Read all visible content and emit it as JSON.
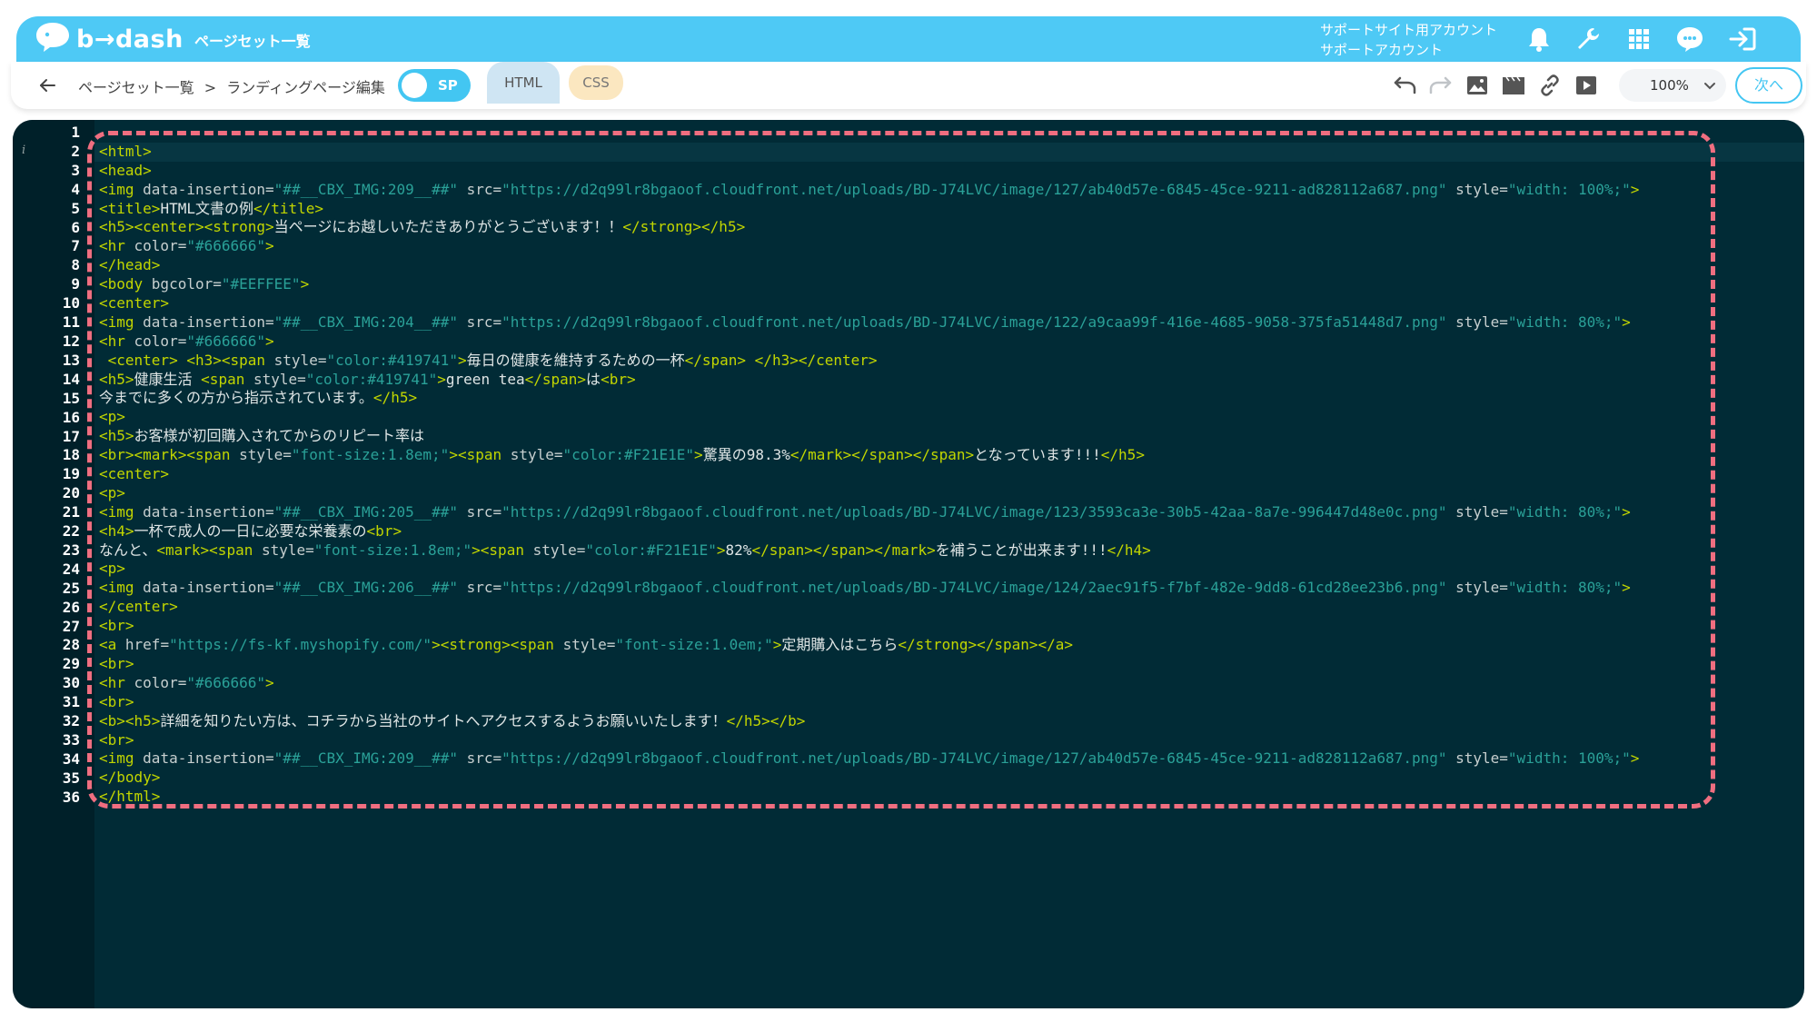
{
  "header": {
    "logo_text": "b→dash",
    "app_title": "ページセット一覧",
    "account_line1": "サポートサイト用アカウント",
    "account_line2": "サポートアカウント"
  },
  "icons": {
    "logo": "speech-bubble-logo-icon",
    "bell": "bell-icon",
    "wrench": "wrench-icon",
    "grid": "apps-grid-icon",
    "help": "support-chat-icon",
    "logout": "logout-icon",
    "back": "back-arrow-icon",
    "undo": "undo-icon",
    "redo": "redo-icon",
    "image": "image-icon",
    "video": "film-icon",
    "link": "link-icon",
    "play": "play-icon",
    "chevron": "chevron-down-icon"
  },
  "toolbar": {
    "breadcrumb_root": "ページセット一覧",
    "breadcrumb_sep": ">",
    "breadcrumb_current": "ランディングページ編集",
    "toggle_label": "SP",
    "tab_html": "HTML",
    "tab_css": "CSS",
    "zoom": "100%",
    "next_label": "次へ"
  },
  "colors": {
    "header_blue": "#4ec9f5",
    "editor_bg": "#012b36",
    "tag": "#c2d600",
    "string": "#2aa198",
    "highlight_border": "#f06e80"
  },
  "editor": {
    "line_count": 36,
    "lines": [
      [],
      [
        [
          "t",
          "<html>"
        ]
      ],
      [
        [
          "t",
          "<head>"
        ]
      ],
      [
        [
          "t",
          "<img "
        ],
        [
          "a",
          "data-insertion="
        ],
        [
          "s",
          "\"##__CBX_IMG:209__##\""
        ],
        [
          "a",
          " src="
        ],
        [
          "s",
          "\"https://d2q99lr8bgaoof.cloudfront.net/uploads/BD-J74LVC/image/127/ab40d57e-6845-45ce-9211-ad828112a687.png\""
        ],
        [
          "a",
          " style="
        ],
        [
          "s",
          "\"width: 100%;\""
        ],
        [
          "t",
          ">"
        ]
      ],
      [
        [
          "t",
          "<title>"
        ],
        [
          "x",
          "HTML文書の例"
        ],
        [
          "t",
          "</title>"
        ]
      ],
      [
        [
          "t",
          "<h5><center><strong>"
        ],
        [
          "x",
          "当ページにお越しいただきありがとうございます！！"
        ],
        [
          "t",
          "</strong></h5>"
        ]
      ],
      [
        [
          "t",
          "<hr "
        ],
        [
          "a",
          "color="
        ],
        [
          "s",
          "\"#666666\""
        ],
        [
          "t",
          ">"
        ]
      ],
      [
        [
          "t",
          "</head>"
        ]
      ],
      [
        [
          "t",
          "<body "
        ],
        [
          "a",
          "bgcolor="
        ],
        [
          "s",
          "\"#EEFFEE\""
        ],
        [
          "t",
          ">"
        ]
      ],
      [
        [
          "t",
          "<center>"
        ]
      ],
      [
        [
          "t",
          "<img "
        ],
        [
          "a",
          "data-insertion="
        ],
        [
          "s",
          "\"##__CBX_IMG:204__##\""
        ],
        [
          "a",
          " src="
        ],
        [
          "s",
          "\"https://d2q99lr8bgaoof.cloudfront.net/uploads/BD-J74LVC/image/122/a9caa99f-416e-4685-9058-375fa51448d7.png\""
        ],
        [
          "a",
          " style="
        ],
        [
          "s",
          "\"width: 80%;\""
        ],
        [
          "t",
          ">"
        ]
      ],
      [
        [
          "t",
          "<hr "
        ],
        [
          "a",
          "color="
        ],
        [
          "s",
          "\"#666666\""
        ],
        [
          "t",
          ">"
        ]
      ],
      [
        [
          "t",
          " <center> <h3><span "
        ],
        [
          "a",
          "style="
        ],
        [
          "s",
          "\"color:#419741\""
        ],
        [
          "t",
          ">"
        ],
        [
          "x",
          "毎日の健康を維持するための一杯"
        ],
        [
          "t",
          "</span> </h3></center>"
        ]
      ],
      [
        [
          "t",
          "<h5>"
        ],
        [
          "x",
          "健康生活 "
        ],
        [
          "t",
          "<span "
        ],
        [
          "a",
          "style="
        ],
        [
          "s",
          "\"color:#419741\""
        ],
        [
          "t",
          ">"
        ],
        [
          "x",
          "green tea"
        ],
        [
          "t",
          "</span>"
        ],
        [
          "x",
          "は"
        ],
        [
          "t",
          "<br>"
        ]
      ],
      [
        [
          "x",
          "今までに多くの方から指示されています。"
        ],
        [
          "t",
          "</h5>"
        ]
      ],
      [
        [
          "t",
          "<p>"
        ]
      ],
      [
        [
          "t",
          "<h5>"
        ],
        [
          "x",
          "お客様が初回購入されてからのリピート率は"
        ]
      ],
      [
        [
          "t",
          "<br><mark><span "
        ],
        [
          "a",
          "style="
        ],
        [
          "s",
          "\"font-size:1.8em;\""
        ],
        [
          "t",
          "><span "
        ],
        [
          "a",
          "style="
        ],
        [
          "s",
          "\"color:#F21E1E\""
        ],
        [
          "t",
          ">"
        ],
        [
          "x",
          "驚異の98.3%"
        ],
        [
          "t",
          "</mark></span></span>"
        ],
        [
          "x",
          "となっています!!!"
        ],
        [
          "t",
          "</h5>"
        ]
      ],
      [
        [
          "t",
          "<center>"
        ]
      ],
      [
        [
          "t",
          "<p>"
        ]
      ],
      [
        [
          "t",
          "<img "
        ],
        [
          "a",
          "data-insertion="
        ],
        [
          "s",
          "\"##__CBX_IMG:205__##\""
        ],
        [
          "a",
          " src="
        ],
        [
          "s",
          "\"https://d2q99lr8bgaoof.cloudfront.net/uploads/BD-J74LVC/image/123/3593ca3e-30b5-42aa-8a7e-996447d48e0c.png\""
        ],
        [
          "a",
          " style="
        ],
        [
          "s",
          "\"width: 80%;\""
        ],
        [
          "t",
          ">"
        ]
      ],
      [
        [
          "t",
          "<h4>"
        ],
        [
          "x",
          "一杯で成人の一日に必要な栄養素の"
        ],
        [
          "t",
          "<br>"
        ]
      ],
      [
        [
          "x",
          "なんと、"
        ],
        [
          "t",
          "<mark><span "
        ],
        [
          "a",
          "style="
        ],
        [
          "s",
          "\"font-size:1.8em;\""
        ],
        [
          "t",
          "><span "
        ],
        [
          "a",
          "style="
        ],
        [
          "s",
          "\"color:#F21E1E\""
        ],
        [
          "t",
          ">"
        ],
        [
          "x",
          "82%"
        ],
        [
          "t",
          "</span></span></mark>"
        ],
        [
          "x",
          "を補うことが出来ます!!!"
        ],
        [
          "t",
          "</h4>"
        ]
      ],
      [
        [
          "t",
          "<p>"
        ]
      ],
      [
        [
          "t",
          "<img "
        ],
        [
          "a",
          "data-insertion="
        ],
        [
          "s",
          "\"##__CBX_IMG:206__##\""
        ],
        [
          "a",
          " src="
        ],
        [
          "s",
          "\"https://d2q99lr8bgaoof.cloudfront.net/uploads/BD-J74LVC/image/124/2aec91f5-f7bf-482e-9dd8-61cd28ee23b6.png\""
        ],
        [
          "a",
          " style="
        ],
        [
          "s",
          "\"width: 80%;\""
        ],
        [
          "t",
          ">"
        ]
      ],
      [
        [
          "t",
          "</center>"
        ]
      ],
      [
        [
          "t",
          "<br>"
        ]
      ],
      [
        [
          "t",
          "<a "
        ],
        [
          "a",
          "href="
        ],
        [
          "s",
          "\"https://fs-kf.myshopify.com/\""
        ],
        [
          "t",
          "><strong><span "
        ],
        [
          "a",
          "style="
        ],
        [
          "s",
          "\"font-size:1.0em;\""
        ],
        [
          "t",
          ">"
        ],
        [
          "x",
          "定期購入はこちら"
        ],
        [
          "t",
          "</strong></span></a>"
        ]
      ],
      [
        [
          "t",
          "<br>"
        ]
      ],
      [
        [
          "t",
          "<hr "
        ],
        [
          "a",
          "color="
        ],
        [
          "s",
          "\"#666666\""
        ],
        [
          "t",
          ">"
        ]
      ],
      [
        [
          "t",
          "<br>"
        ]
      ],
      [
        [
          "t",
          "<b><h5>"
        ],
        [
          "x",
          "詳細を知りたい方は、コチラから当社のサイトへアクセスするようお願いいたします！"
        ],
        [
          "t",
          "</h5></b>"
        ]
      ],
      [
        [
          "t",
          "<br>"
        ]
      ],
      [
        [
          "t",
          "<img "
        ],
        [
          "a",
          "data-insertion="
        ],
        [
          "s",
          "\"##__CBX_IMG:209__##\""
        ],
        [
          "a",
          " src="
        ],
        [
          "s",
          "\"https://d2q99lr8bgaoof.cloudfront.net/uploads/BD-J74LVC/image/127/ab40d57e-6845-45ce-9211-ad828112a687.png\""
        ],
        [
          "a",
          " style="
        ],
        [
          "s",
          "\"width: 100%;\""
        ],
        [
          "t",
          ">"
        ]
      ],
      [
        [
          "t",
          "</body>"
        ]
      ],
      [
        [
          "t",
          "</html>"
        ]
      ]
    ]
  }
}
